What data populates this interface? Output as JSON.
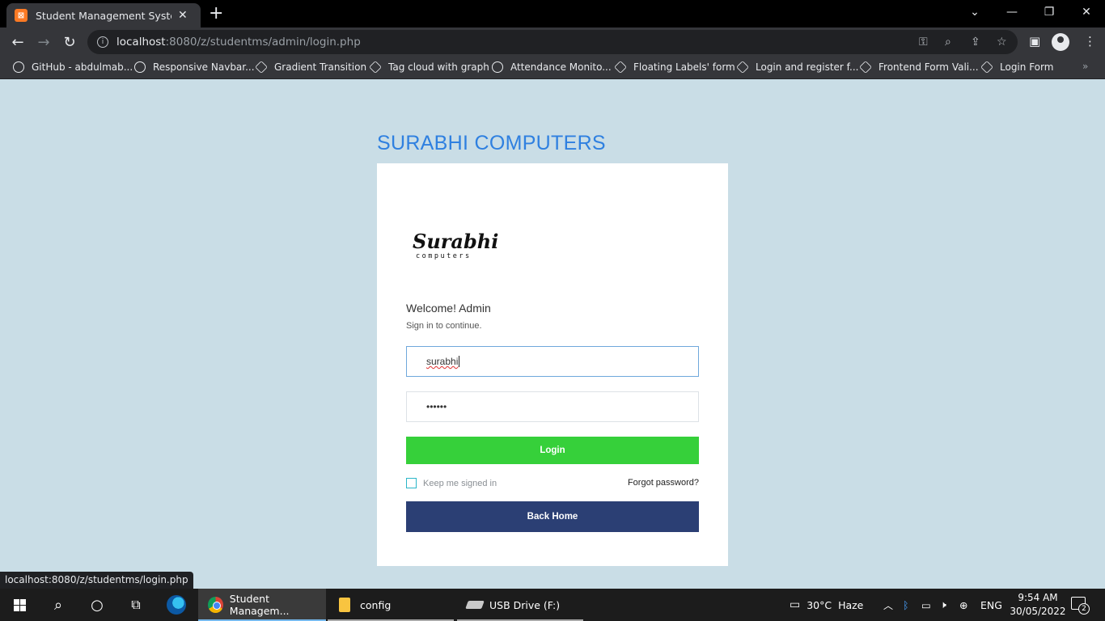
{
  "browser": {
    "tab_title": "Student Management System|| Lo",
    "tab_favicon": "xampp-icon",
    "url_host": "localhost",
    "url_path": ":8080/z/studentms/admin/login.php",
    "new_tab": "+",
    "window_controls": {
      "minimize": "—",
      "maximize": "❐",
      "close": "✕",
      "tab_search": "⌄"
    }
  },
  "bookmarks": [
    {
      "label": "GitHub - abdulmab...",
      "icon": "github-icon"
    },
    {
      "label": "Responsive Navbar...",
      "icon": "moon-icon"
    },
    {
      "label": "Gradient Transition",
      "icon": "codepen-icon"
    },
    {
      "label": "Tag cloud with graph",
      "icon": "codepen-icon"
    },
    {
      "label": "Attendance Monito...",
      "icon": "globe-icon"
    },
    {
      "label": "Floating Labels' form",
      "icon": "codepen-icon"
    },
    {
      "label": "Login and register f...",
      "icon": "codepen-icon"
    },
    {
      "label": "Frontend Form Vali...",
      "icon": "codepen-icon"
    },
    {
      "label": "Login Form",
      "icon": "codepen-icon"
    }
  ],
  "page": {
    "brand_title": "SURABHI COMPUTERS",
    "logo_word": "Surabhi",
    "logo_sub": "computers",
    "welcome": "Welcome! Admin",
    "signin_text": "Sign in to continue.",
    "username_value": "surabhi",
    "password_value": "••••••",
    "login_label": "Login",
    "keep_signed_in": "Keep me signed in",
    "forgot_password": "Forgot password?",
    "back_home": "Back Home"
  },
  "status_url": "localhost:8080/z/studentms/login.php",
  "taskbar": {
    "chrome_label": "Student Managem...",
    "folder_label": "config",
    "drive_label": "USB Drive (F:)",
    "weather": "30°C  Haze",
    "language": "ENG",
    "time": "9:54 AM",
    "date": "30/05/2022",
    "notifications": "2"
  },
  "colors": {
    "page_bg": "#c9dde6",
    "brand_blue": "#2f80e0",
    "login_green": "#36d03a",
    "home_navy": "#2b3f74"
  }
}
